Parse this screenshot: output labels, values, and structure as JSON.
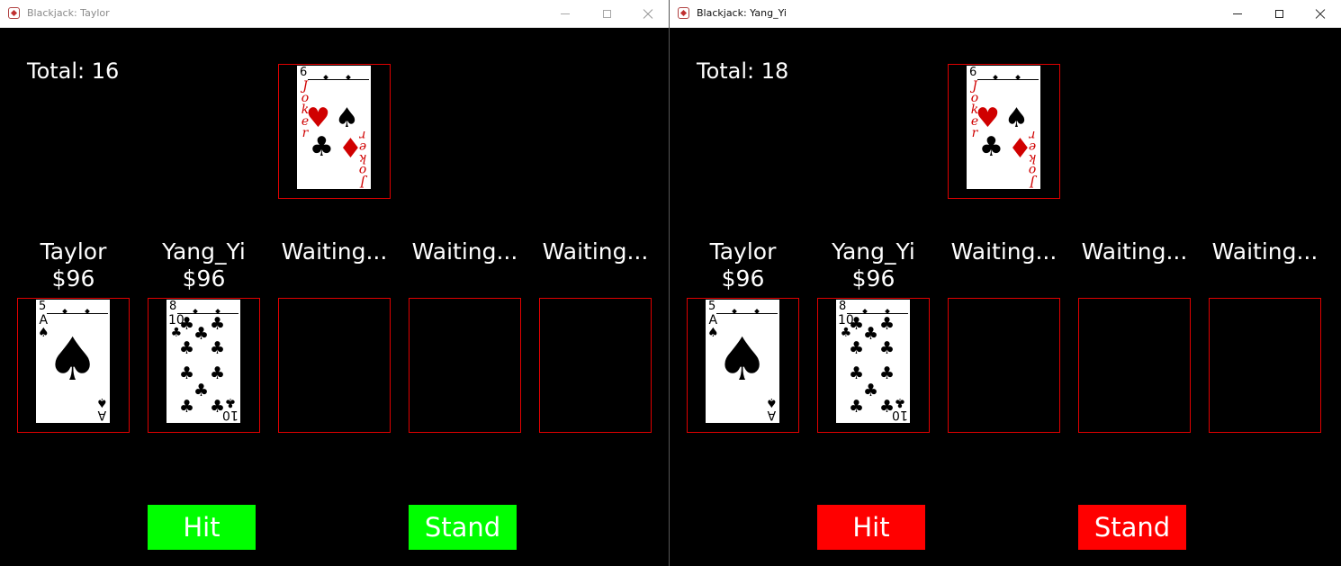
{
  "windows": [
    {
      "title": "Blackjack: Taylor",
      "total": "Total: 16",
      "button_color": "#00ff00",
      "buttons": {
        "hit": "Hit",
        "stand": "Stand"
      },
      "dealer_card": {
        "rank": "6",
        "label": "Joker"
      },
      "players": [
        {
          "name": "Taylor",
          "money": "$96",
          "card": {
            "rank": "5",
            "corner": "A",
            "suit": "♠"
          }
        },
        {
          "name": "Yang_Yi",
          "money": "$96",
          "card": {
            "rank": "8",
            "corner": "10",
            "suit": "♣"
          }
        },
        {
          "name": "Waiting..."
        },
        {
          "name": "Waiting..."
        },
        {
          "name": "Waiting..."
        }
      ]
    },
    {
      "title": "Blackjack: Yang_Yi",
      "total": "Total: 18",
      "button_color": "#ff0000",
      "buttons": {
        "hit": "Hit",
        "stand": "Stand"
      },
      "dealer_card": {
        "rank": "6",
        "label": "Joker"
      },
      "players": [
        {
          "name": "Taylor",
          "money": "$96",
          "card": {
            "rank": "5",
            "corner": "A",
            "suit": "♠"
          }
        },
        {
          "name": "Yang_Yi",
          "money": "$96",
          "card": {
            "rank": "8",
            "corner": "10",
            "suit": "♣"
          }
        },
        {
          "name": "Waiting..."
        },
        {
          "name": "Waiting..."
        },
        {
          "name": "Waiting..."
        }
      ]
    }
  ]
}
